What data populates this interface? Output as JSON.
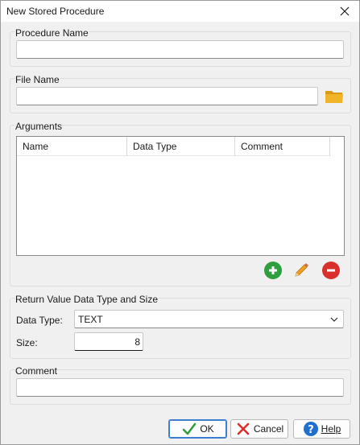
{
  "window": {
    "title": "New Stored Procedure"
  },
  "procedure_name": {
    "label": "Procedure Name",
    "value": ""
  },
  "file_name": {
    "label": "File Name",
    "value": ""
  },
  "arguments": {
    "label": "Arguments",
    "columns": [
      "Name",
      "Data Type",
      "Comment"
    ],
    "rows": []
  },
  "return_value": {
    "label": "Return Value Data Type and Size",
    "data_type_label": "Data Type:",
    "data_type_value": "TEXT",
    "size_label": "Size:",
    "size_value": "8"
  },
  "comment": {
    "label": "Comment",
    "value": ""
  },
  "buttons": {
    "ok": "OK",
    "cancel": "Cancel",
    "help": "Help"
  },
  "colors": {
    "add": "#2e9e3e",
    "edit": "#f0a020",
    "remove": "#d9302b",
    "help": "#1f6fd1",
    "folder": "#f0b429"
  }
}
